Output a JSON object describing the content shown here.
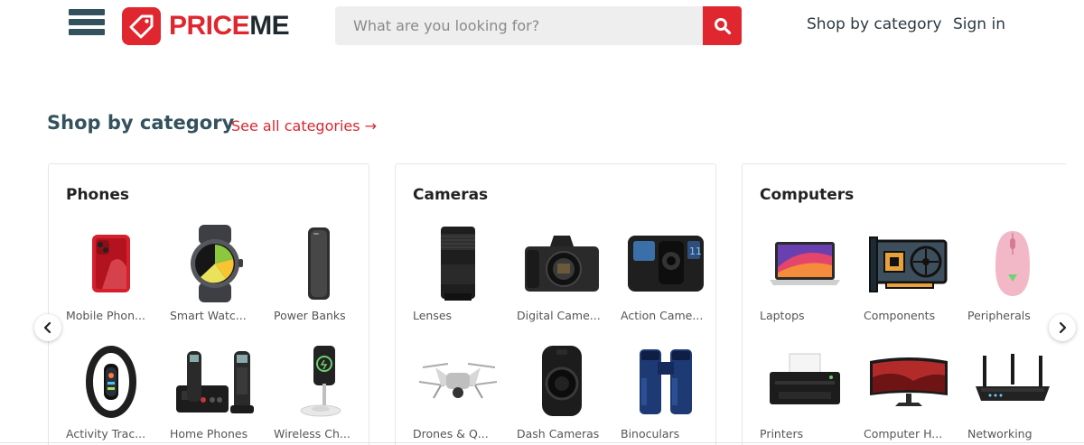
{
  "header": {
    "logo_text_1": "PRICE",
    "logo_text_2": "ME",
    "search_placeholder": "What are you looking for?",
    "nav_shop": "Shop by category",
    "nav_signin": "Sign in"
  },
  "section": {
    "title": "Shop by category",
    "see_all": "See all categories →"
  },
  "cards": [
    {
      "title": "Phones",
      "items": [
        {
          "label": "Mobile Phon...",
          "icon": "smartphone-icon"
        },
        {
          "label": "Smart Watc...",
          "icon": "smartwatch-icon"
        },
        {
          "label": "Power Banks",
          "icon": "power-bank-icon"
        },
        {
          "label": "Activity Trac...",
          "icon": "activity-tracker-icon"
        },
        {
          "label": "Home Phones",
          "icon": "home-phone-icon"
        },
        {
          "label": "Wireless Ch...",
          "icon": "wireless-charger-icon"
        }
      ]
    },
    {
      "title": "Cameras",
      "items": [
        {
          "label": "Lenses",
          "icon": "lens-icon"
        },
        {
          "label": "Digital Came...",
          "icon": "digital-camera-icon"
        },
        {
          "label": "Action Came...",
          "icon": "action-camera-icon"
        },
        {
          "label": "Drones & Q...",
          "icon": "drone-icon"
        },
        {
          "label": "Dash Cameras",
          "icon": "dash-camera-icon"
        },
        {
          "label": "Binoculars",
          "icon": "binoculars-icon"
        }
      ]
    },
    {
      "title": "Computers",
      "items": [
        {
          "label": "Laptops",
          "icon": "laptop-icon"
        },
        {
          "label": "Components",
          "icon": "graphics-card-icon"
        },
        {
          "label": "Peripherals",
          "icon": "mouse-icon"
        },
        {
          "label": "Printers",
          "icon": "printer-icon"
        },
        {
          "label": "Computer H...",
          "icon": "monitor-icon"
        },
        {
          "label": "Networking",
          "icon": "router-icon"
        }
      ]
    }
  ],
  "colors": {
    "brand_red": "#e0262e",
    "heading_teal": "#34525e"
  }
}
